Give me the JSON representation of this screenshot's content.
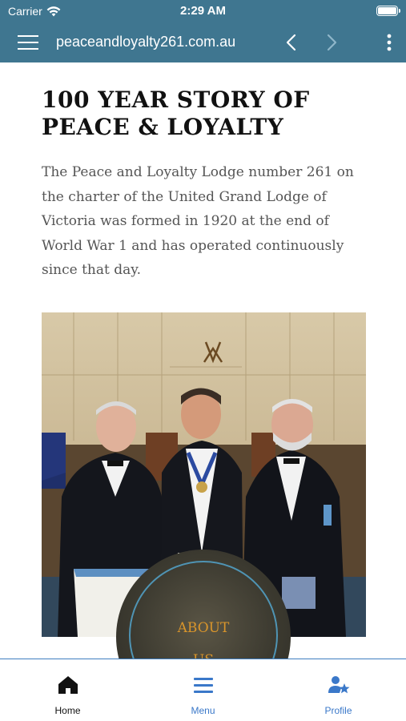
{
  "status_bar": {
    "carrier": "Carrier",
    "time": "2:29 AM"
  },
  "nav": {
    "url": "peaceandloyalty261.com.au"
  },
  "main": {
    "title_line1": "100 YEAR STORY OF",
    "title_line2": "PEACE & LOYALTY",
    "intro": "The Peace and Loyalty Lodge number 261 on the charter of the United Grand Lodge of Victoria was formed in 1920 at the end of World War 1 and has operated continuously since that day.",
    "about_line1": "ABOUT",
    "about_line2": "US"
  },
  "tabs": [
    {
      "label": "Home",
      "icon": "home-icon"
    },
    {
      "label": "Menu",
      "icon": "menu-icon"
    },
    {
      "label": "Profile",
      "icon": "profile-icon"
    }
  ],
  "colors": {
    "header": "#3f7690",
    "accent": "#3a78c9",
    "about_text": "#d9952b"
  }
}
